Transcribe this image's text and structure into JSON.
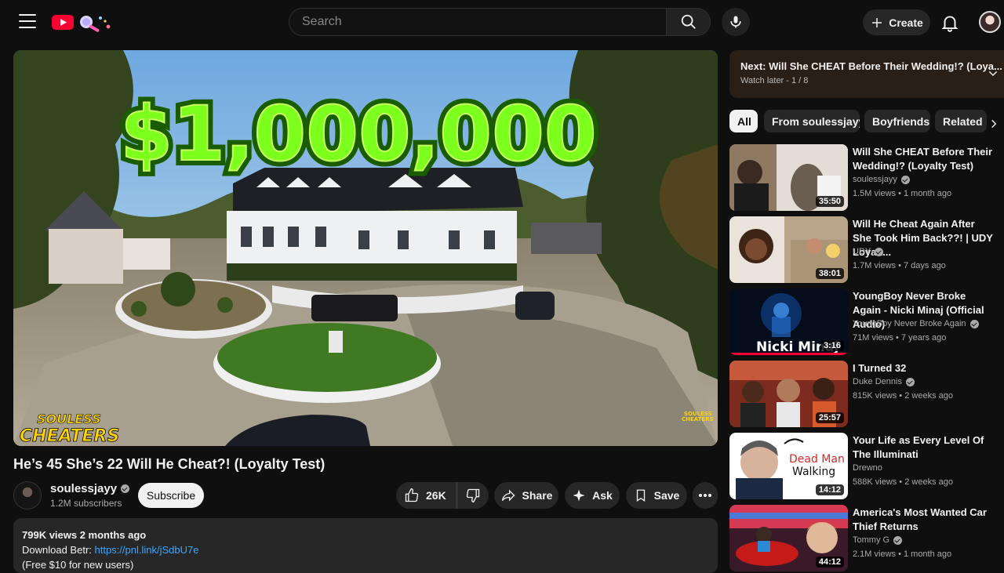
{
  "header": {
    "search_placeholder": "Search",
    "create_label": "Create"
  },
  "player": {
    "thumbnail_headline": "$1,000,000",
    "watermark_line1": "SOULESS",
    "watermark_line2": "CHEATERS",
    "corner_watermark_line1": "SOULESS",
    "corner_watermark_line2": "CHEATERS"
  },
  "video": {
    "title": "He’s 45 She’s 22 Will He Cheat?! (Loyalty Test)",
    "channel": "soulessjayy",
    "subscribers": "1.2M subscribers",
    "subscribe_label": "Subscribe",
    "likes": "26K",
    "share_label": "Share",
    "ask_label": "Ask",
    "save_label": "Save"
  },
  "description": {
    "stats": "799K views  2 months ago",
    "line2_prefix": "Download Betr: ",
    "link": "https://pnl.link/jSdbU7e",
    "line3": "(Free $10 for new users)"
  },
  "up_next": {
    "title": "Next: Will She CHEAT Before Their Wedding!? (Loya...",
    "subtitle": "Watch later - 1 / 8"
  },
  "chips": [
    "All",
    "From soulessjayy",
    "Boyfriends",
    "Related"
  ],
  "recommendations": [
    {
      "title": "Will She CHEAT Before Their Wedding!? (Loyalty Test)",
      "channel": "soulessjayy",
      "verified": true,
      "meta": "1.5M views • 1 month ago",
      "duration": "35:50"
    },
    {
      "title": "Will He Cheat Again After She Took Him Back??! | UDY Loyalt...",
      "channel": "UDY",
      "verified": true,
      "meta": "1.7M views • 7 days ago",
      "duration": "38:01"
    },
    {
      "title": "YoungBoy Never Broke Again - Nicki Minaj (Official Audio)",
      "channel": "YoungBoy Never Broke Again",
      "verified": true,
      "meta": "71M views • 7 years ago",
      "duration": "3:16",
      "thumb_text": "Nicki Minaj"
    },
    {
      "title": "I Turned 32",
      "channel": "Duke Dennis",
      "verified": true,
      "meta": "815K views • 2 weeks ago",
      "duration": "25:57"
    },
    {
      "title": "Your Life as Every Level Of The Illuminati",
      "channel": "Drewno",
      "verified": false,
      "meta": "588K views • 2 weeks ago",
      "duration": "14:12",
      "thumb_text_1": "Dead Man",
      "thumb_text_2": "Walking"
    },
    {
      "title": "America's Most Wanted Car Thief Returns",
      "channel": "Tommy G",
      "verified": true,
      "meta": "2.1M views • 1 month ago",
      "duration": "44:12"
    }
  ],
  "colors": {
    "background": "#0f0f0f",
    "chip_bg": "#272727",
    "link": "#3ea6ff",
    "brand_red": "#ff0033",
    "headline_green": "#7dff1e"
  }
}
